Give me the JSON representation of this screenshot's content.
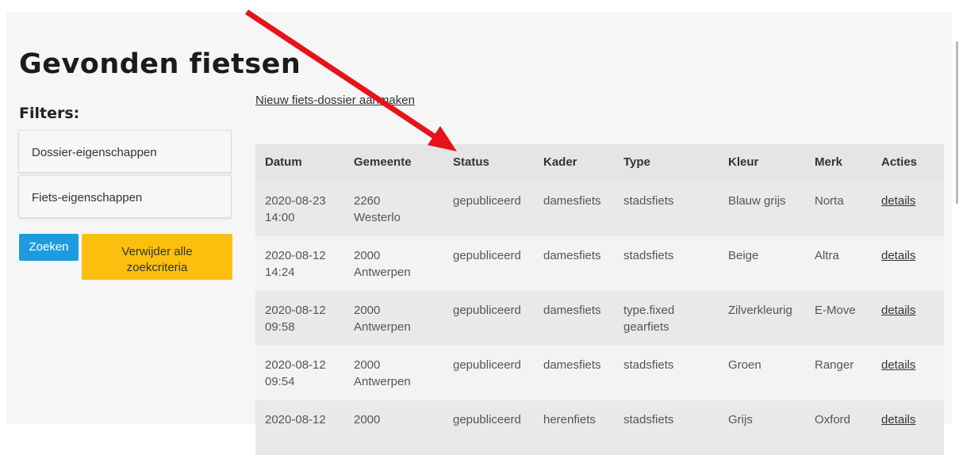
{
  "page": {
    "title": "Gevonden fietsen",
    "filters_title": "Filters:",
    "filter_boxes": [
      "Dossier-eigenschappen",
      "Fiets-eigenschappen"
    ],
    "search_button": "Zoeken",
    "clear_button": "Verwijder alle zoekcriteria",
    "new_link": "Nieuw fiets-dossier aanmaken"
  },
  "table": {
    "headers": [
      "Datum",
      "Gemeente",
      "Status",
      "Kader",
      "Type",
      "Kleur",
      "Merk",
      "Acties"
    ],
    "rows": [
      {
        "datum_date": "2020-08-23",
        "datum_time": "14:00",
        "gemeente_zip": "2260",
        "gemeente_name": "Westerlo",
        "status": "gepubliceerd",
        "kader": "damesfiets",
        "type": "stadsfiets",
        "kleur": "Blauw grijs",
        "merk": "Norta",
        "acties": "details"
      },
      {
        "datum_date": "2020-08-12",
        "datum_time": "14:24",
        "gemeente_zip": "2000",
        "gemeente_name": "Antwerpen",
        "status": "gepubliceerd",
        "kader": "damesfiets",
        "type": "stadsfiets",
        "kleur": "Beige",
        "merk": "Altra",
        "acties": "details"
      },
      {
        "datum_date": "2020-08-12",
        "datum_time": "09:58",
        "gemeente_zip": "2000",
        "gemeente_name": "Antwerpen",
        "status": "gepubliceerd",
        "kader": "damesfiets",
        "type": "type.fixed gearfiets",
        "kleur": "Zilverkleurig",
        "merk": "E-Move",
        "acties": "details"
      },
      {
        "datum_date": "2020-08-12",
        "datum_time": "09:54",
        "gemeente_zip": "2000",
        "gemeente_name": "Antwerpen",
        "status": "gepubliceerd",
        "kader": "damesfiets",
        "type": "stadsfiets",
        "kleur": "Groen",
        "merk": "Ranger",
        "acties": "details"
      },
      {
        "datum_date": "2020-08-12",
        "datum_time": "",
        "gemeente_zip": "2000",
        "gemeente_name": "",
        "status": "gepubliceerd",
        "kader": "herenfiets",
        "type": "stadsfiets",
        "kleur": "Grijs",
        "merk": "Oxford",
        "acties": "details"
      }
    ]
  },
  "colors": {
    "search_button": "#1e9be0",
    "clear_button": "#fdbf0e",
    "arrow": "#e8121b"
  },
  "icons": {
    "annotation": "red-arrow-icon"
  }
}
